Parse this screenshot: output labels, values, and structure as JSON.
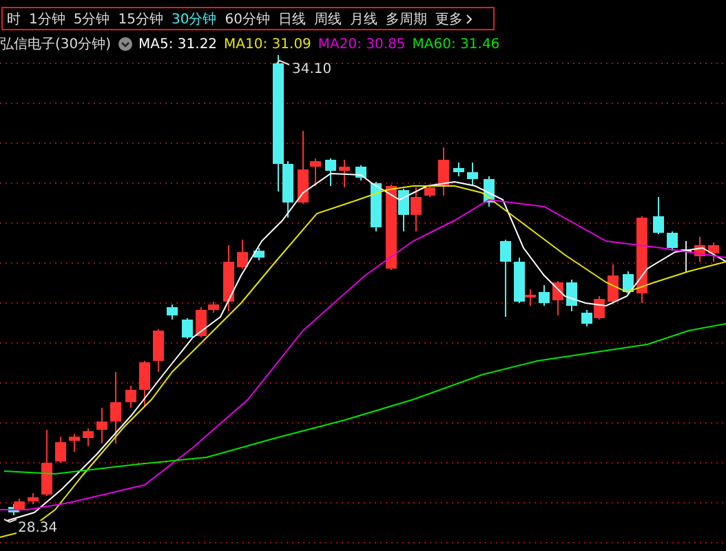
{
  "toolbar": {
    "tabs": [
      {
        "label": "时",
        "selected": false
      },
      {
        "label": "1分钟",
        "selected": false
      },
      {
        "label": "5分钟",
        "selected": false
      },
      {
        "label": "15分钟",
        "selected": false
      },
      {
        "label": "30分钟",
        "selected": true
      },
      {
        "label": "60分钟",
        "selected": false
      },
      {
        "label": "日线",
        "selected": false
      },
      {
        "label": "周线",
        "selected": false
      },
      {
        "label": "月线",
        "selected": false
      },
      {
        "label": "多周期",
        "selected": false
      }
    ],
    "more": {
      "label": "更多"
    }
  },
  "legend": {
    "title": "弘信电子(30分钟)",
    "indicators": [
      {
        "text": "MA5: 31.22",
        "color": "#ffffff"
      },
      {
        "text": "MA10: 31.09",
        "color": "#e6e600"
      },
      {
        "text": "MA20: 30.85",
        "color": "#e600e6"
      },
      {
        "text": "MA60: 31.46",
        "color": "#00e600"
      }
    ]
  },
  "chart": {
    "high_label": "34.10",
    "low_label": "28.34"
  }
}
